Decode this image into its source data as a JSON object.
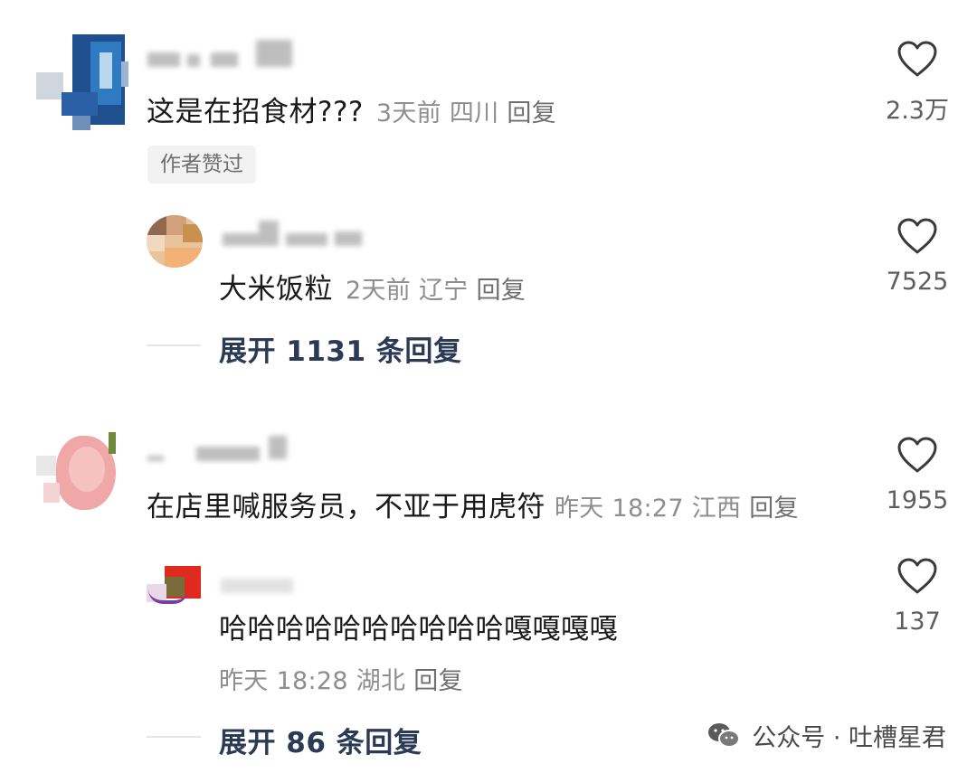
{
  "comments": [
    {
      "text": "这是在招食材???",
      "time": "3天前",
      "location": "四川",
      "reply_label": "回复",
      "likes": "2.3万",
      "badge": "作者赞过",
      "replies": [
        {
          "text": "大米饭粒",
          "time": "2天前",
          "location": "辽宁",
          "reply_label": "回复",
          "likes": "7525"
        }
      ],
      "expand_label": "展开 1131 条回复"
    },
    {
      "text": "在店里喊服务员，不亚于用虎符",
      "time": "昨天 18:27",
      "location": "江西",
      "reply_label": "回复",
      "likes": "1955",
      "replies": [
        {
          "text": "哈哈哈哈哈哈哈哈哈哈嘎嘎嘎嘎",
          "time": "昨天 18:28",
          "location": "湖北",
          "reply_label": "回复",
          "likes": "137"
        }
      ],
      "expand_label": "展开 86 条回复"
    }
  ],
  "watermark": {
    "icon": "wechat-icon",
    "text": "公众号 · 吐槽星君"
  },
  "colors": {
    "meta_gray": "#8e8e8e",
    "expand_blue": "#2b3a55",
    "heart_gray": "#3a3a3a"
  }
}
